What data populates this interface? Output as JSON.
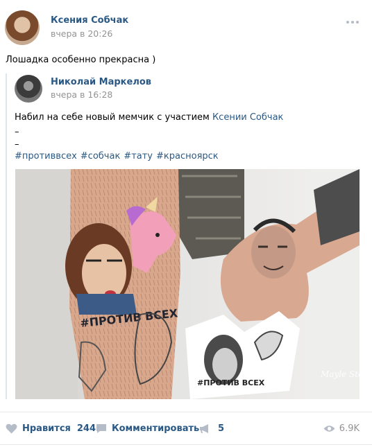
{
  "post": {
    "author": "Ксения Собчак",
    "date": "вчера в 20:26",
    "text": "Лошадка особенно прекрасна )"
  },
  "repost": {
    "author": "Николай Маркелов",
    "date": "вчера в 16:28",
    "text_prefix": "Набил на себе новый мемчик с участием ",
    "mention": "Ксении Собчак",
    "dash1": "–",
    "dash2": "–",
    "hashtags": [
      "#противвсех",
      "#собчак",
      "#тату",
      "#красноярск"
    ]
  },
  "photo": {
    "tattoo_text": "#ПРОТИВ ВСЕХ",
    "sticker_text": "#ПРОТИВ ВСЕХ",
    "watermark": "Mayle Stolezin"
  },
  "actions": {
    "like_label": "Нравится",
    "like_count": "244",
    "comment_label": "Комментировать",
    "share_count": "5",
    "views": "6.9K"
  },
  "colors": {
    "link": "#2a5885",
    "muted": "#939393",
    "icon": "#b4bcc7",
    "divider": "#e7e8ec"
  },
  "icons": {
    "like": "heart-icon",
    "comment": "comment-icon",
    "share": "megaphone-icon",
    "views": "eye-icon",
    "more": "more-dots-icon"
  }
}
